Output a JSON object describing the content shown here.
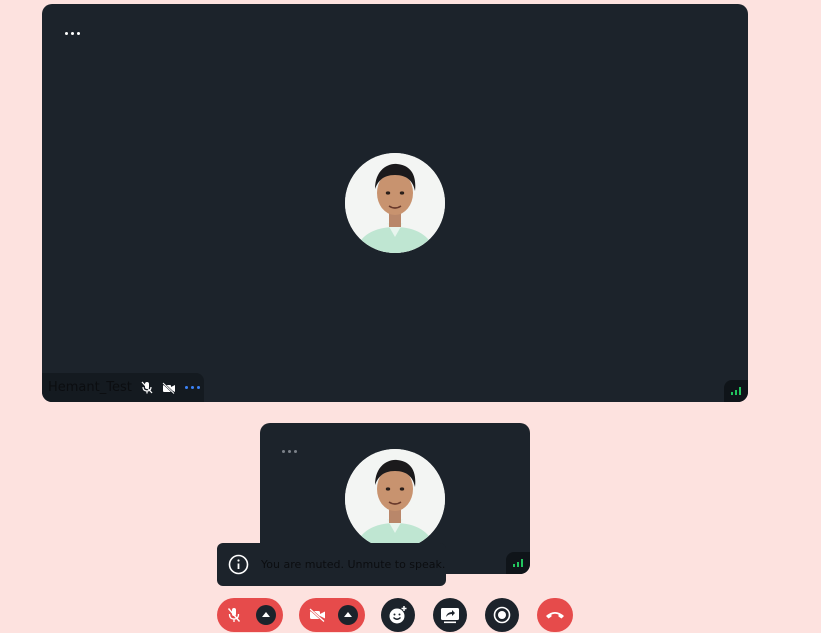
{
  "main_tile": {
    "participant_name": "Hemant_Test",
    "more_icon": "more-horizontal-icon",
    "mic_status_icon": "mic-off-icon",
    "camera_status_icon": "video-off-icon",
    "options_icon": "more-horizontal-icon",
    "signal_icon": "signal-bars-icon",
    "signal_color": "#22c55e"
  },
  "self_view": {
    "more_icon": "more-horizontal-icon",
    "signal_icon": "signal-bars-icon"
  },
  "toast": {
    "icon": "info-icon",
    "message": "You are muted. Unmute to speak."
  },
  "controls": [
    {
      "name": "mic",
      "icon": "mic-off-icon",
      "state": "off",
      "color": "#e64b4b"
    },
    {
      "name": "camera",
      "icon": "video-off-icon",
      "state": "off",
      "color": "#e64b4b"
    },
    {
      "name": "reactions",
      "icon": "emoji-add-icon"
    },
    {
      "name": "share-screen",
      "icon": "screen-share-icon"
    },
    {
      "name": "record",
      "icon": "record-icon"
    },
    {
      "name": "leave",
      "icon": "phone-hangup-icon",
      "color": "#e64b4b"
    }
  ]
}
